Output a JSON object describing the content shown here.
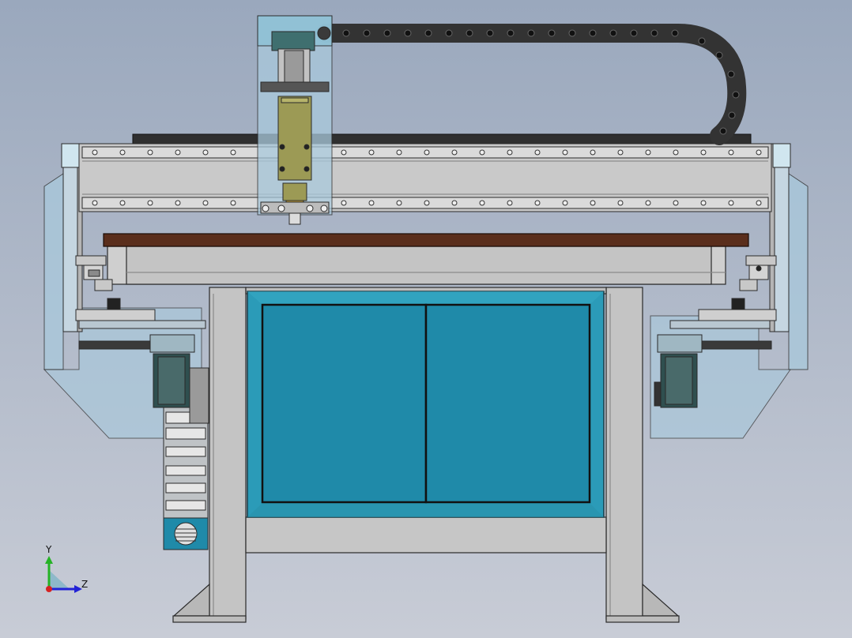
{
  "viewport": {
    "background_top": "#9aa8bd",
    "background_bottom": "#c8ccd6"
  },
  "colors": {
    "steel": "#c4c4c4",
    "steel_dark": "#a9a9a9",
    "outline": "#2a2a2a",
    "glass": "#a9c9dc",
    "panel_teal": "#1f8aa9",
    "panel_frame": "#2b9bb8",
    "wood": "#5a2e1c",
    "spindle_olive": "#9c9a55",
    "chain": "#333333",
    "axis_y": "#25b325",
    "axis_z": "#2222d6",
    "axis_x": "#d62222"
  },
  "triad": {
    "y_label": "Y",
    "z_label": "Z"
  },
  "model": {
    "components": [
      "gantry-beam",
      "linear-rail",
      "spindle-carriage",
      "cable-drag-chain",
      "wood-table-top",
      "machine-base-frame",
      "control-panel",
      "side-stepper-motor-left",
      "side-stepper-motor-right",
      "electrical-cabinet"
    ]
  }
}
